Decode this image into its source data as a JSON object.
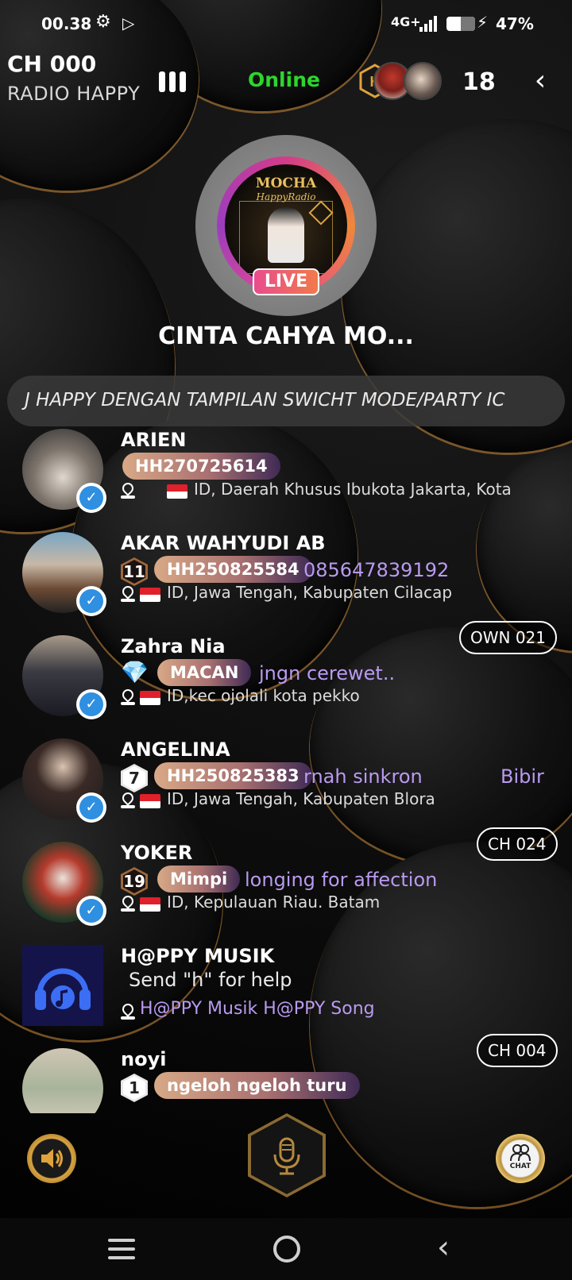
{
  "status_bar": {
    "time": "00.38",
    "network": "4G+",
    "battery": "47%",
    "icons": [
      "gear-icon",
      "play-store-icon",
      "signal-icon",
      "battery-icon",
      "charging-icon"
    ]
  },
  "header": {
    "channel": "CH 000",
    "station": "RADIO HAPPY",
    "status": "Online",
    "listener_count": "18"
  },
  "live": {
    "artwork_title": "MOCHA",
    "artwork_subtitle": "HappyRadio",
    "badge": "LIVE",
    "show_title": "CINTA CAHYA MO..."
  },
  "marquee": {
    "text": "J HAPPY DENGAN TAMPILAN SWICHT MODE/PARTY IC"
  },
  "users": [
    {
      "name": "ARIEN",
      "tag": "HH270725614",
      "location": "ID, Daerah Khusus Ibukota Jakarta, Kota",
      "verified": true
    },
    {
      "name": "AKAR WAHYUDI AB",
      "level": "11",
      "tag": "HH250825584",
      "status": "085647839192",
      "location": "ID, Jawa Tengah, Kabupaten Cilacap",
      "verified": true
    },
    {
      "name": "Zahra Nia",
      "tag": "MACAN",
      "status": "jngn cerewet..",
      "location": "ID,kec ojolali kota pekko",
      "channel": "OWN 021",
      "verified": true
    },
    {
      "name": "ANGELINA",
      "level": "7",
      "tag": "HH250825383",
      "status": "rnah sinkron",
      "status2": "Bibir",
      "location": "ID, Jawa Tengah, Kabupaten Blora",
      "verified": true
    },
    {
      "name": "YOKER",
      "level": "19",
      "tag": "Mimpi",
      "status": "longing for affection",
      "location": "ID, Kepulauan Riau. Batam",
      "channel": "CH 024",
      "verified": true
    },
    {
      "name": "H@PPY MUSIK",
      "help": "Send \"h\" for help",
      "links": "H@PPY Musik  H@PPY Song"
    },
    {
      "name": "noyi",
      "level": "1",
      "tag": "ngeloh ngeloh turu",
      "channel": "CH 004"
    }
  ],
  "controls": {
    "speaker": "speaker-icon",
    "mic": "microphone-icon",
    "chat": "CHAT"
  },
  "colors": {
    "online": "#2cd62c",
    "status_text": "#b99af0",
    "accent_gold": "#d9a441"
  }
}
